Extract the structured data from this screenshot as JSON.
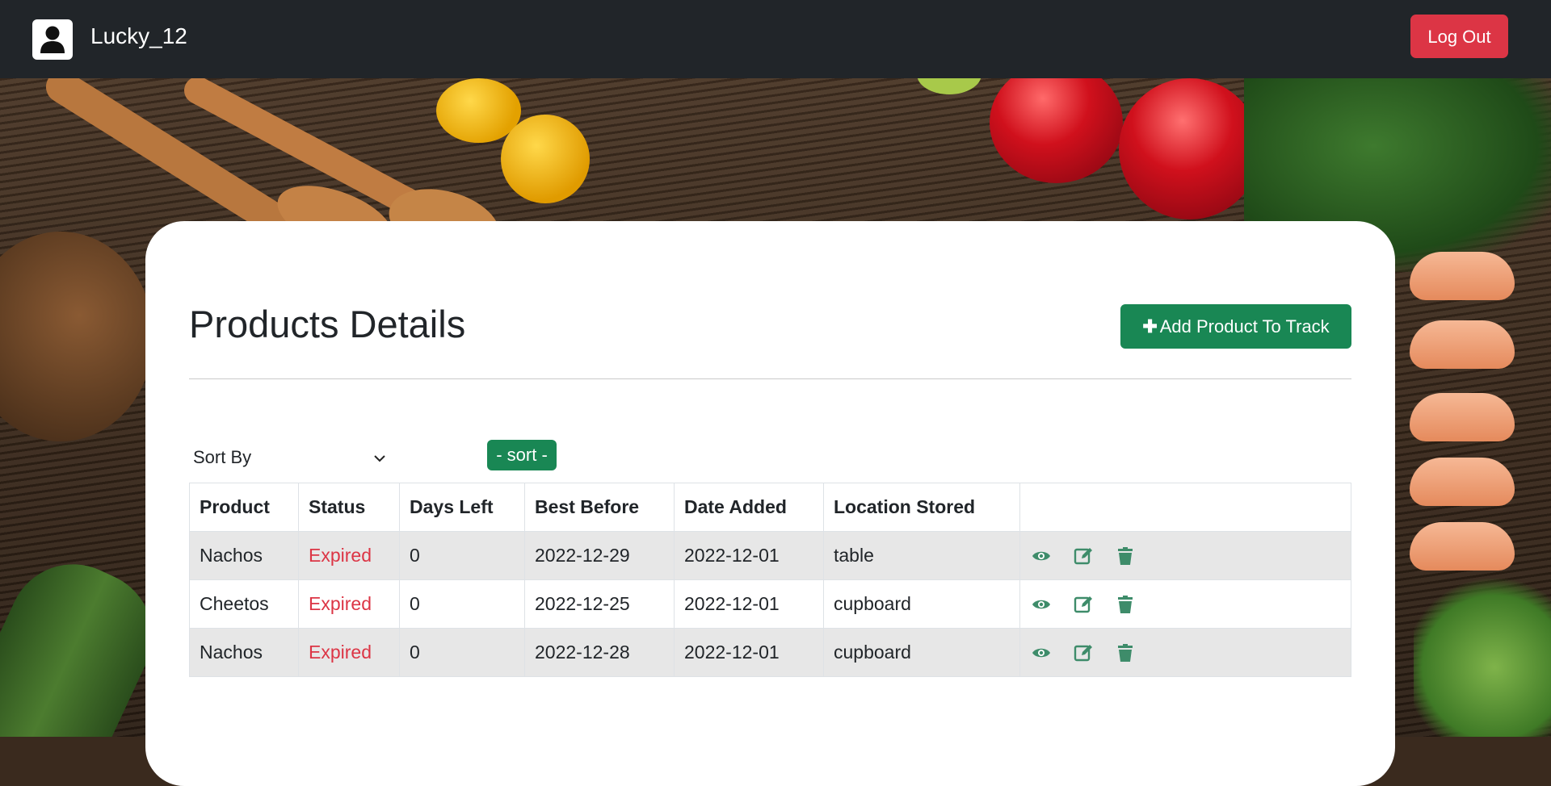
{
  "navbar": {
    "username": "Lucky_12",
    "logout_label": "Log Out",
    "avatar_icon": "user-icon"
  },
  "main": {
    "title": "Products Details",
    "add_button_label": "Add Product To Track",
    "add_icon": "plus-icon",
    "sort_select_value": "Sort By",
    "sort_button_label": "- sort -"
  },
  "table": {
    "headers": [
      "Product",
      "Status",
      "Days Left",
      "Best Before",
      "Date Added",
      "Location Stored",
      ""
    ],
    "rows": [
      {
        "product": "Nachos",
        "status": "Expired",
        "days_left": "0",
        "best_before": "2022-12-29",
        "date_added": "2022-12-01",
        "location": "table"
      },
      {
        "product": "Cheetos",
        "status": "Expired",
        "days_left": "0",
        "best_before": "2022-12-25",
        "date_added": "2022-12-01",
        "location": "cupboard"
      },
      {
        "product": "Nachos",
        "status": "Expired",
        "days_left": "0",
        "best_before": "2022-12-28",
        "date_added": "2022-12-01",
        "location": "cupboard"
      }
    ],
    "row_actions": [
      "eye-icon",
      "edit-icon",
      "trash-icon"
    ]
  },
  "colors": {
    "navbar": "#212529",
    "danger": "#dc3545",
    "success": "#198754",
    "action_icons": "#3e8c6a"
  }
}
